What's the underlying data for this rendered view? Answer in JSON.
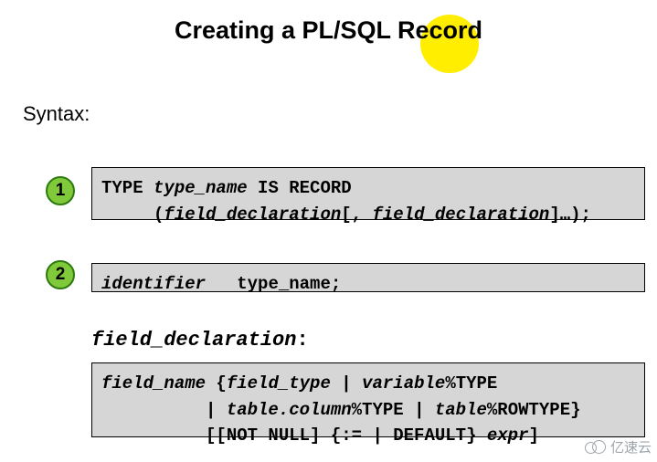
{
  "title": "Creating a PL/SQL Record",
  "syntax_label": "Syntax:",
  "steps": {
    "n1": "1",
    "n2": "2"
  },
  "code": {
    "block1_line1_a": "TYPE ",
    "block1_line1_b": "type_name",
    "block1_line1_c": " IS RECORD",
    "block1_line2_a": "     (",
    "block1_line2_b": "field_declaration",
    "block1_line2_c": "[, ",
    "block1_line2_d": "field_declaration",
    "block1_line2_e": "]…);",
    "block2_a": "identifier",
    "block2_b": "   type_name;",
    "field_decl_label": "field_declaration",
    "field_decl_colon": ":",
    "block3_l1_a": "field_name",
    "block3_l1_b": " {",
    "block3_l1_c": "field_type",
    "block3_l1_d": " | ",
    "block3_l1_e": "variable",
    "block3_l1_f": "%TYPE",
    "block3_l2_a": "          | ",
    "block3_l2_b": "table.column",
    "block3_l2_c": "%TYPE | ",
    "block3_l2_d": "table",
    "block3_l2_e": "%ROWTYPE}",
    "block3_l3_a": "          [[NOT NULL] {:= | DEFAULT} ",
    "block3_l3_b": "expr",
    "block3_l3_c": "]"
  },
  "watermark": "亿速云"
}
